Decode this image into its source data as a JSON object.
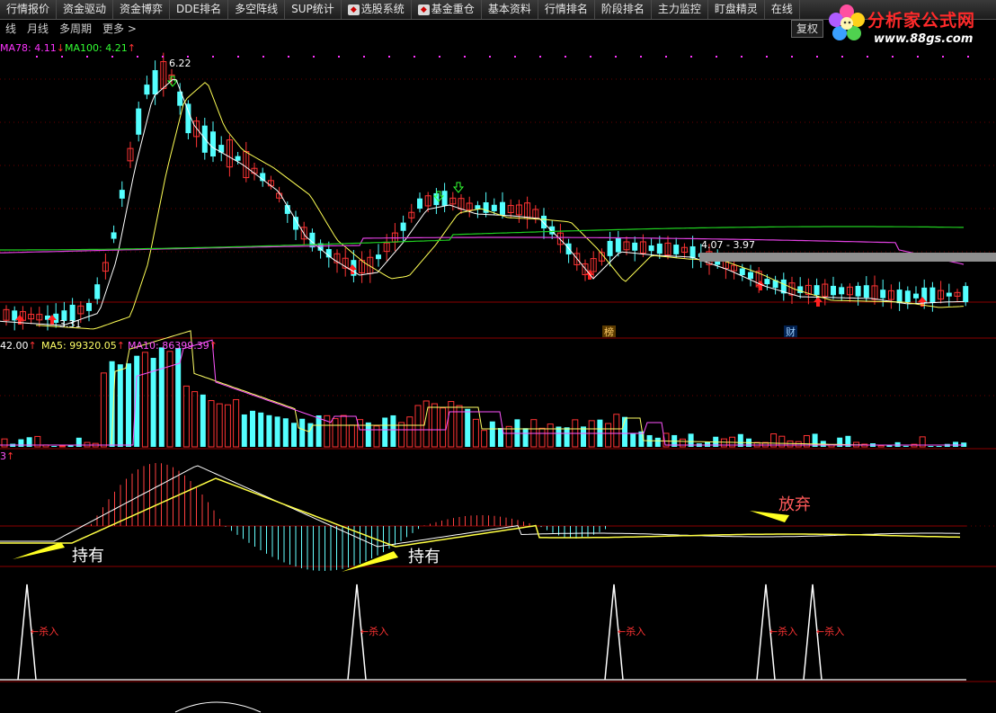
{
  "menubar": {
    "items": [
      {
        "label": "行情报价"
      },
      {
        "label": "资金驱动"
      },
      {
        "label": "资金博弈"
      },
      {
        "label": "DDE排名"
      },
      {
        "label": "多空阵线"
      },
      {
        "label": "SUP统计"
      },
      {
        "label": "选股系统",
        "icon": "stock-picker-icon"
      },
      {
        "label": "基金重仓",
        "icon": "fund-icon"
      },
      {
        "label": "基本资料"
      },
      {
        "label": "行情排名"
      },
      {
        "label": "阶段排名"
      },
      {
        "label": "主力监控"
      },
      {
        "label": "盯盘精灵"
      },
      {
        "label": "在线"
      }
    ]
  },
  "toolbar": {
    "periods": [
      "线",
      "月线",
      "多周期",
      "更多 >"
    ],
    "restore_label": "复权"
  },
  "logo": {
    "name": "分析家公式网",
    "url": "www.88gs.com"
  },
  "price_panel": {
    "ma_legend": [
      {
        "text": "MA78: 4.11",
        "arrow": "↓",
        "color": "#ff33ff"
      },
      {
        "text": "MA100: 4.21",
        "arrow": "↑",
        "color": "#33ff33"
      }
    ],
    "high_label": "6.22",
    "low_label": "3.31",
    "range_label": "4.07 - 3.97",
    "markers": [
      "榜",
      "财"
    ]
  },
  "volume_panel": {
    "legend": [
      {
        "text": "42.00",
        "arrow": "↑",
        "color": "#ffffff"
      },
      {
        "text": "MA5: 99320.05",
        "arrow": "↑",
        "color": "#ffff66"
      },
      {
        "text": "MA10: 86399.39",
        "arrow": "↑",
        "color": "#ff55ff"
      }
    ]
  },
  "macd_panel": {
    "legend": "3",
    "legend_arrow": "↑",
    "annotations": [
      "持有",
      "持有",
      "放弃"
    ]
  },
  "signal_panel": {
    "label": "杀入"
  },
  "colors": {
    "up": "#ff3333",
    "down": "#54ffff",
    "ma_white": "#ffffff",
    "ma_yellow": "#ffff55",
    "ma_magenta": "#e040e0",
    "ma_green": "#20d020",
    "grid": "#8b0000"
  }
}
